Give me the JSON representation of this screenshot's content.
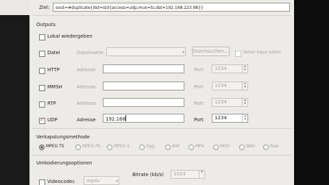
{
  "target": {
    "label": "Ziel:",
    "value": "sout=#duplicate{dst=std{access=udp,mux=ts,dst=192.168.223.98}}"
  },
  "outputs": {
    "title": "Outputs",
    "local": {
      "label": "Lokal wiedergeben",
      "checked": false
    },
    "file": {
      "label": "Datei",
      "name_label": "Dateiname",
      "browse_label": "Durchsuchen...",
      "raw_label": "Roher Input sofern",
      "checked": false
    },
    "rows": [
      {
        "id": "http",
        "label": "HTTP",
        "address_label": "Adresse",
        "address": "",
        "port_label": "Port",
        "port": "1234",
        "checked": false
      },
      {
        "id": "mmsh",
        "label": "MMSH",
        "address_label": "Adresse",
        "address": "",
        "port_label": "Port",
        "port": "1234",
        "checked": false
      },
      {
        "id": "rtp",
        "label": "RTP",
        "address_label": "Adresse",
        "address": "",
        "port_label": "Port",
        "port": "1234",
        "checked": false
      },
      {
        "id": "udp",
        "label": "UDP",
        "address_label": "Adresse",
        "address": "192.168",
        "port_label": "Port",
        "port": "1234",
        "checked": true
      }
    ]
  },
  "encapsulation": {
    "title": "Verkapslungsmethode",
    "options": [
      "MPEG TS",
      "MPEG PS",
      "MPEG 1",
      "Ogg",
      "ASF",
      "MP4",
      "MOV",
      "WAV",
      "Raw"
    ],
    "selected": "MPEG TS"
  },
  "transcoding": {
    "title": "Umkodierungsoptionen",
    "video_label": "Videocodec",
    "video_codec": "mp4v",
    "video_checked": false,
    "bitrate_label": "Bitrate (kb/s)",
    "bitrate": "1024"
  },
  "colors": {
    "dialog_bg": "#ecebe7",
    "check_mark": "#c8331a"
  }
}
